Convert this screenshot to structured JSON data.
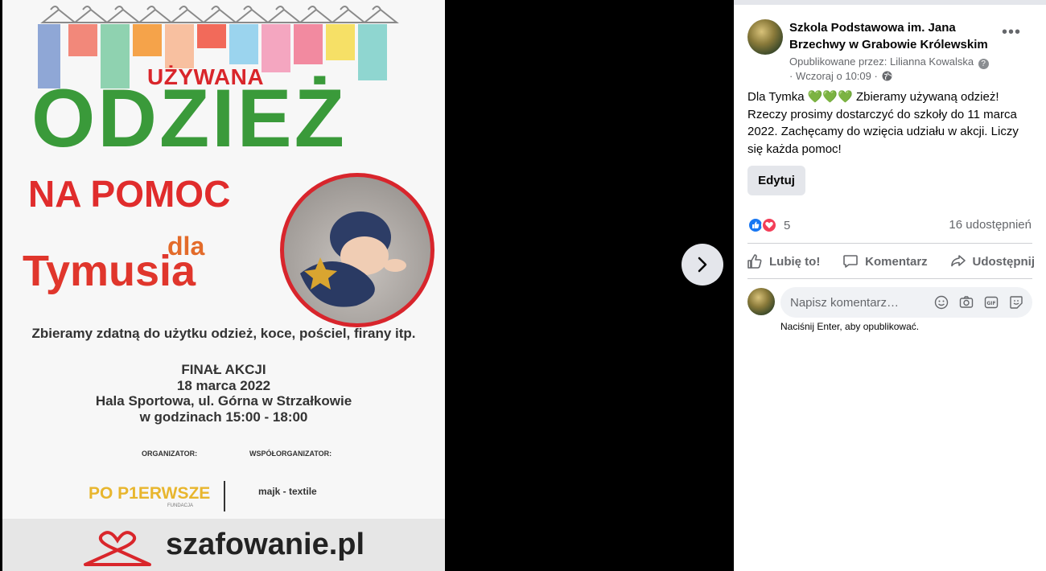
{
  "poster": {
    "line1": "UŻYWANA",
    "line2": "ODZIEŻ",
    "line3": "NA POMOC",
    "line4": "dla",
    "line5": "Tymusia",
    "collect_text": "Zbieramy zdatną do użytku odzież, koce, pościel, firany itp.",
    "final_title": "FINAŁ AKCJI",
    "final_date": "18 marca 2022",
    "final_place": "Hala Sportowa, ul. Górna w Strzałkowie",
    "final_hours": "w godzinach 15:00 - 18:00",
    "organizer_label": "ORGANIZATOR:",
    "coorganizer_label": "WSPÓŁORGANIZATOR:",
    "organizer_name": "PO P1ERWSZE",
    "organizer_sub": "FUNDACJA",
    "coorganizer_name": "majk - textile",
    "sponsor": "szafowanie.pl"
  },
  "viewer": {
    "next_icon": "chevron-right-icon"
  },
  "post": {
    "page_name": "Szkola Podstawowa im. Jana Brzechwy w Grabowie Królewskim",
    "published_by": "Opublikowane przez: Lilianna Kowalska",
    "time": "· Wczoraj o 10:09 ·",
    "body_prefix": "Dla Tymka",
    "body_hearts": "💚💚💚",
    "body_rest": " Zbieramy używaną odzież! Rzeczy prosimy dostarczyć do szkoły do 11 marca 2022. Zachęcamy do wzięcia udziału w akcji. Liczy się każda pomoc!",
    "edit_label": "Edytuj",
    "reaction_count": "5",
    "shares": "16 udostępnień"
  },
  "actions": {
    "like": "Lubię to!",
    "comment": "Komentarz",
    "share": "Udostępnij"
  },
  "comment": {
    "placeholder": "Napisz komentarz…",
    "hint": "Naciśnij Enter, aby opublikować."
  },
  "colors": {
    "fb_blue": "#1877f2",
    "love_red": "#f33e58",
    "poster_green": "#3a9a3a",
    "poster_red": "#e02c2c"
  }
}
